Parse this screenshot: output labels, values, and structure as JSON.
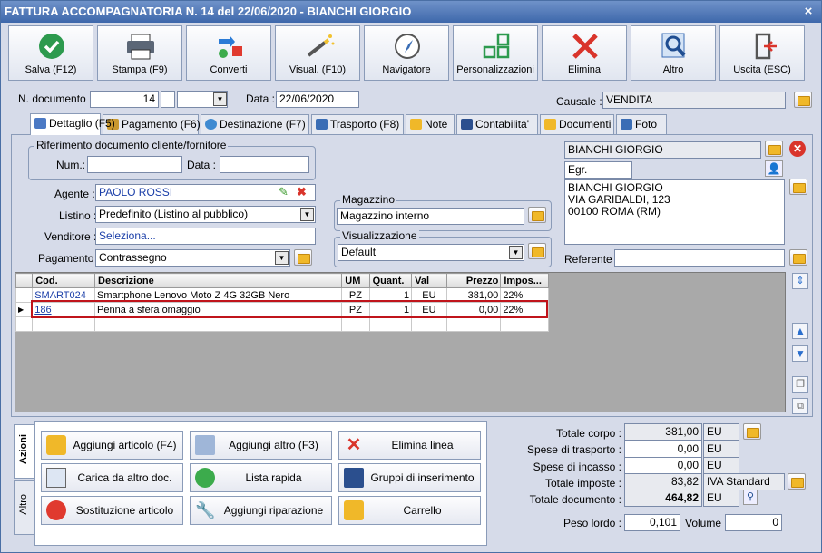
{
  "window": {
    "title": "FATTURA ACCOMPAGNATORIA N. 14 del 22/06/2020 - BIANCHI GIORGIO",
    "close": "×"
  },
  "toolbar": [
    {
      "label": "Salva (F12)",
      "icon": "save-check-icon"
    },
    {
      "label": "Stampa (F9)",
      "icon": "printer-icon"
    },
    {
      "label": "Converti",
      "icon": "convert-icon"
    },
    {
      "label": "Visual. (F10)",
      "icon": "magic-wand-icon"
    },
    {
      "label": "Navigatore",
      "icon": "compass-icon"
    },
    {
      "label": "Personalizzazioni",
      "icon": "grid-icon"
    },
    {
      "label": "Elimina",
      "icon": "delete-x-icon"
    },
    {
      "label": "Altro",
      "icon": "magnifier-icon"
    },
    {
      "label": "Uscita (ESC)",
      "icon": "exit-door-icon"
    }
  ],
  "header": {
    "doc_label": "N. documento :",
    "doc_number": "14",
    "doc_suffix": "",
    "date_label": "Data :",
    "date": "22/06/2020",
    "causale_label": "Causale :",
    "causale": "VENDITA"
  },
  "tabs": [
    "Dettaglio (F5)",
    "Pagamento (F6)",
    "Destinazione (F7)",
    "Trasporto (F8)",
    "Note",
    "Contabilita'",
    "Documenti",
    "Foto"
  ],
  "rif": {
    "title": "Riferimento documento cliente/fornitore",
    "num_label": "Num.:",
    "num": "",
    "data_label": "Data :",
    "data": ""
  },
  "form": {
    "agente_label": "Agente :",
    "agente": "PAOLO ROSSI",
    "listino_label": "Listino :",
    "listino": "Predefinito (Listino al pubblico)",
    "venditore_label": "Venditore :",
    "venditore": "Seleziona...",
    "pagamento_label": "Pagamento :",
    "pagamento": "Contrassegno",
    "magazzino_title": "Magazzino",
    "magazzino": "Magazzino interno",
    "visual_title": "Visualizzazione",
    "visual": "Default"
  },
  "cliente": {
    "name": "BIANCHI GIORGIO",
    "salutation": "Egr.",
    "address": [
      "BIANCHI GIORGIO",
      "VIA GARIBALDI, 123",
      "00100 ROMA (RM)"
    ],
    "referente_label": "Referente",
    "referente": ""
  },
  "grid": {
    "columns": [
      "Cod.",
      "Descrizione",
      "UM",
      "Quant.",
      "Val",
      "Prezzo",
      "Impos..."
    ],
    "rows": [
      {
        "cod": "SMART024",
        "desc": "Smartphone Lenovo Moto Z 4G 32GB Nero",
        "um": "PZ",
        "qty": "1",
        "val": "EU",
        "price": "381,00",
        "tax": "22%"
      },
      {
        "cod": "186",
        "desc": "Penna a sfera omaggio",
        "um": "PZ",
        "qty": "1",
        "val": "EU",
        "price": "0,00",
        "tax": "22%"
      }
    ]
  },
  "actions": {
    "vtabs": [
      "Azioni",
      "Altro"
    ],
    "buttons": [
      "Aggiungi articolo (F4)",
      "Aggiungi altro (F3)",
      "Elimina linea",
      "Carica da altro doc.",
      "Lista rapida",
      "Gruppi di inserimento",
      "Sostituzione articolo",
      "Aggiungi riparazione",
      "Carrello"
    ]
  },
  "totals": {
    "corpo_label": "Totale corpo :",
    "corpo": "381,00",
    "corpo_cur": "EU",
    "trasporto_label": "Spese di trasporto :",
    "trasporto": "0,00",
    "trasporto_cur": "EU",
    "incasso_label": "Spese di incasso :",
    "incasso": "0,00",
    "incasso_cur": "EU",
    "imposte_label": "Totale imposte :",
    "imposte": "83,82",
    "imposte_note": "IVA Standard",
    "documento_label": "Totale documento :",
    "documento": "464,82",
    "documento_cur": "EU",
    "peso_label": "Peso lordo :",
    "peso": "0,101",
    "volume_label": "Volume :",
    "volume": "0"
  }
}
